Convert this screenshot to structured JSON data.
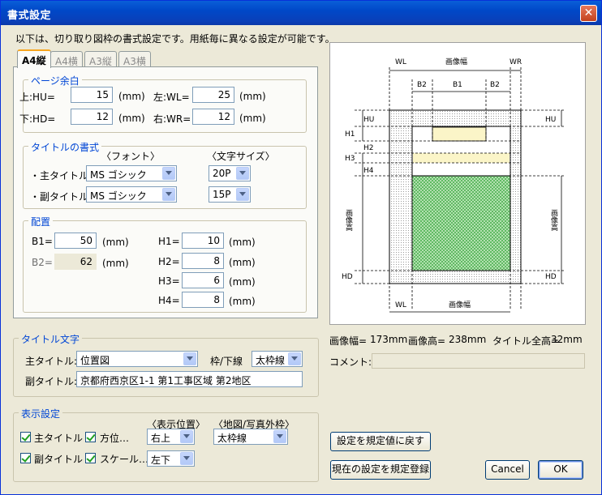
{
  "window": {
    "title": "書式設定",
    "close_glyph": "✕"
  },
  "intro_text": "以下は、切り取り図枠の書式設定です。用紙毎に異なる設定が可能です。",
  "tabs": [
    "A4縦",
    "A4横",
    "A3縦",
    "A3横"
  ],
  "page_margin": {
    "title": "ページ余白",
    "top_label": "上:HU=",
    "top_value": "15",
    "bottom_label": "下:HD=",
    "bottom_value": "12",
    "left_label": "左:WL=",
    "left_value": "25",
    "right_label": "右:WR=",
    "right_value": "12",
    "unit": "(mm)"
  },
  "title_format": {
    "title": "タイトルの書式",
    "font_header": "〈フォント〉",
    "size_header": "〈文字サイズ〉",
    "main_label": "・主タイトル:",
    "main_font": "MS ゴシック",
    "main_size": "20P",
    "sub_label": "・副タイトル:",
    "sub_font": "MS ゴシック",
    "sub_size": "15P"
  },
  "layout": {
    "title": "配置",
    "b1_label": "B1=",
    "b1_value": "50",
    "b2_label": "B2=",
    "b2_value": "62",
    "h1_label": "H1=",
    "h1_value": "10",
    "h2_label": "H2=",
    "h2_value": "8",
    "h3_label": "H3=",
    "h3_value": "6",
    "h4_label": "H4=",
    "h4_value": "8",
    "unit": "(mm)"
  },
  "title_text": {
    "title": "タイトル文字",
    "main_label": "主タイトル:",
    "main_value": "位置図",
    "frame_label": "枠/下線",
    "frame_value": "太枠線",
    "sub_label": "副タイトル:",
    "sub_value": "京都府西京区1-1 第1工事区域 第2地区"
  },
  "display": {
    "title": "表示設定",
    "position_header": "〈表示位置〉",
    "frame_header": "〈地図/写真外枠〉",
    "main_title_label": "主タイトル",
    "main_title_checked": true,
    "sub_title_label": "副タイトル",
    "sub_title_checked": true,
    "compass_label": "方位…",
    "compass_checked": true,
    "compass_position": "右上",
    "scale_label": "スケール…",
    "scale_checked": true,
    "scale_position": "左下",
    "frame_value": "太枠線"
  },
  "diagram": {
    "wl": "WL",
    "wr": "WR",
    "image_width": "画像幅",
    "image_height": "画像高",
    "b1": "B1",
    "b2": "B2",
    "hu": "HU",
    "hd": "HD",
    "h1": "H1",
    "h2": "H2",
    "h3": "H3",
    "h4": "H4"
  },
  "summary": {
    "width_label": "画像幅=",
    "width_value": "173mm",
    "height_label": "画像高=",
    "height_value": "238mm",
    "title_height_label": "タイトル全高=",
    "title_height_value": "32mm",
    "comment_label": "コメント:",
    "comment_value": ""
  },
  "buttons": {
    "reset": "設定を規定値に戻す",
    "register": "現在の設定を規定登録",
    "cancel": "Cancel",
    "ok": "OK"
  },
  "colors": {
    "titlebar": "#0048c8",
    "group_title": "#0046d5",
    "title_band": "#fbf5c8",
    "map_hatch": "#4caf50"
  }
}
